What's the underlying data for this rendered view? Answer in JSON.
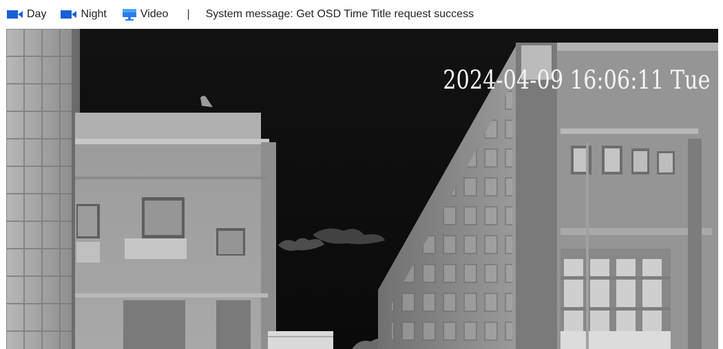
{
  "toolbar": {
    "day_label": "Day",
    "night_label": "Night",
    "video_label": "Video",
    "separator": "|",
    "system_message": "System message: Get OSD Time Title request success",
    "day_icon": "video-camera-icon",
    "night_icon": "video-camera-icon",
    "video_icon": "monitor-icon",
    "accent_color": "#1a5fd6"
  },
  "video": {
    "osd_timestamp": "2024-04-09 16:06:11 Tue",
    "mode": "thermal-grayscale"
  }
}
